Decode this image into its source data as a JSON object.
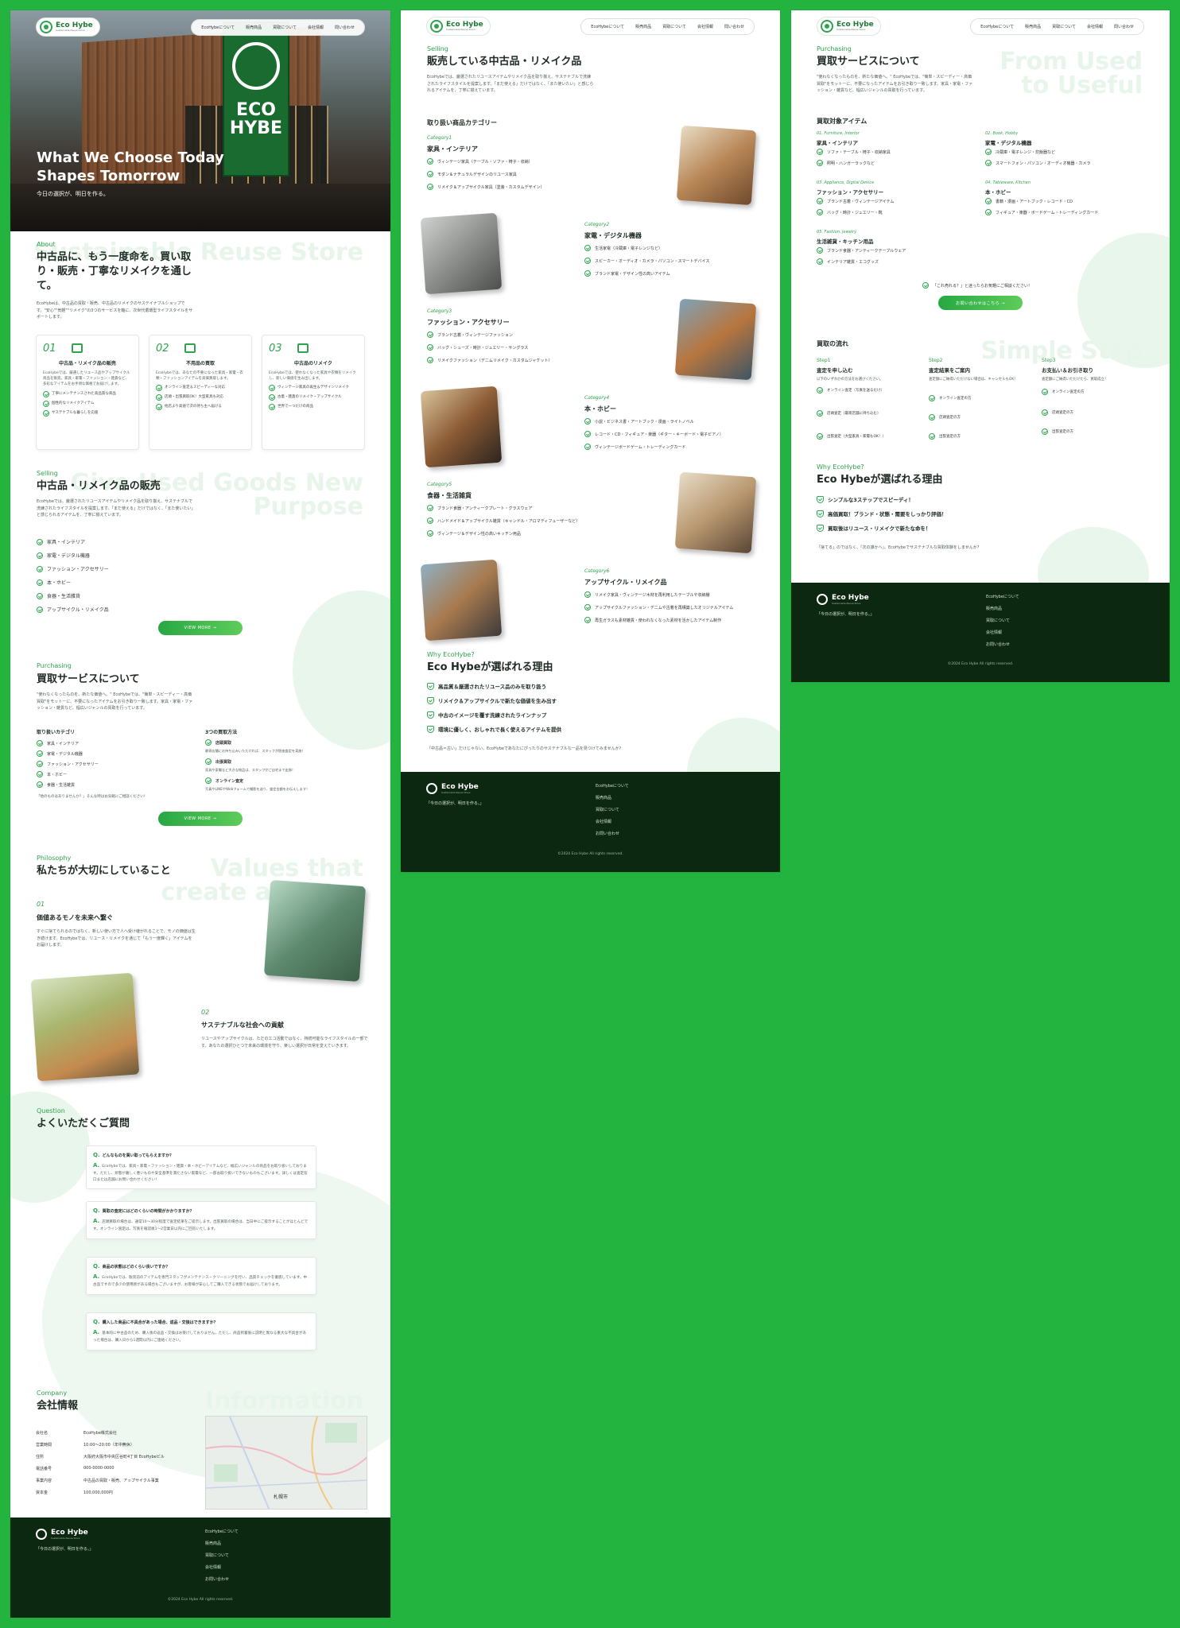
{
  "brand": {
    "name": "Eco Hybe",
    "tagline": "Sustainable Reuse Store"
  },
  "nav": [
    "EcoHybeについて",
    "販売商品",
    "買取について",
    "会社情報",
    "問い合わせ"
  ],
  "hero": {
    "title_line1": "What We Choose Today",
    "title_line2": "Shapes Tomorrow",
    "subtitle": "今日の選択が、明日を作る。",
    "sign_text": "ECO HYBE"
  },
  "about": {
    "eyebrow": "About",
    "heading": "中古品に、もう一度命を。買い取り・販売・丁寧なリメイクを通して。",
    "bgword": "Sustainable Reuse Store",
    "text": "EcoHybeは、中古品の買取・販売、中古品のリメイクのサステイナブルショップです。\"安心\"\"気軽\"\"リメイク\"の3つのサービスを軸に、次世代循環型ライフスタイルをサポートします。",
    "cards": [
      {
        "num": "01",
        "icon": "store-icon",
        "title": "中古品・リメイク品の販売",
        "text": "EcoHybeでは、厳選したリユース品やアップサイクル商品を販売。家具・家電・ファッション・雑貨など、多彩なアイテムをお手頃な価格でお届けします。",
        "items": [
          "丁寧にメンテナンスされた高品質な商品",
          "個性的なリメイクアイテム",
          "サステナブルな暮らしを応援"
        ]
      },
      {
        "num": "02",
        "icon": "scale-icon",
        "title": "不用品の買取",
        "text": "EcoHybeでは、あなたの不要になった家具・家電・衣類・ファッションアイテムを高価買取します。",
        "items": [
          "オンライン査定＆スピーディーな対応",
          "店頭・出張買取OK！大型家具も対応",
          "他店より高値で次の持ち主へ届ける"
        ]
      },
      {
        "num": "03",
        "icon": "tools-icon",
        "title": "中古品のリメイク",
        "text": "EcoHybeでは、使わなくなった家具や衣類をリメイクし、新しい価値を生み出します。",
        "items": [
          "ヴィンテージ家具の再生＆デザインリメイク",
          "古着・雑貨のリメイク・アップサイクル",
          "世界で一つだけの商品"
        ]
      }
    ]
  },
  "selling": {
    "eyebrow": "Selling",
    "heading": "中古品・リメイク品の販売",
    "bgword": "Give Used Goods New Purpose",
    "text": "EcoHybeでは、厳選されたリユースアイテムやリメイク品を取り揃え、サステナブルで洗練されたライフスタイルを提案します。「まだ使える」だけではなく、「また使いたい」と感じられるアイテムを、丁寧に揃えています。",
    "items": [
      "家具・インテリア",
      "家電・デジタル機器",
      "ファッション・アクセサリー",
      "本・ホビー",
      "食器・生活雑貨",
      "アップサイクル・リメイク品"
    ],
    "button": "VIEW MORE →"
  },
  "purchasing": {
    "eyebrow": "Purchasing",
    "heading": "買取サービスについて",
    "text": "\"使わなくなったものを、新たな価値へ。\" EcoHybeでは、\"簡単・スピーディー・高価買取\"をモットーに、不要になったアイテムをお引き取り一致します。家具・家電・ファッション・雑貨など、幅広いジャンルの買取を行っています。",
    "cat_heading": "取り扱いカテゴリ",
    "categories": [
      "家具・インテリア",
      "家電・デジタル機器",
      "ファッション・アクセサリー",
      "本・ホビー",
      "食器・生活雑貨"
    ],
    "cat_note": "「他のものはありませんか？」そんな時はお気軽にご相談ください！",
    "method_heading": "3つの買取方法",
    "methods": [
      {
        "title": "店頭買取",
        "text": "最寄店舗にお持ち込みいただければ、スタッフが即座査定を実施！"
      },
      {
        "title": "出張買取",
        "text": "家具や家電など大きな物品は、スタッフがご自宅まで出張！"
      },
      {
        "title": "オンライン査定",
        "text": "写真やLINEやWebフォームで撮影を送り、査定金額をお伝えします！"
      }
    ],
    "button": "VIEW MORE →"
  },
  "philosophy": {
    "eyebrow": "Philosophy",
    "heading": "私たちが大切にしていること",
    "bgword": "Values that create a better",
    "items": [
      {
        "num": "01",
        "title": "価値あるモノを未来へ繋ぐ",
        "text": "すぐに捨てられるのではなく、新しい使い方で人へ受け継がれることで、モノの価値は生き続けます。EcoHybeでは、リユース・リメイクを通じて「もう一度輝く」アイテムをお届けします。"
      },
      {
        "num": "02",
        "title": "サステナブルな社会への貢献",
        "text": "リユースやアップサイクルは、ただのエコ活動ではなく、持続可能なライフスタイルの一部です。あなたの選択ひとつで未来の環境を守り、楽しい選択が日常を変えていきます。"
      }
    ]
  },
  "faq": {
    "eyebrow": "Question",
    "heading": "よくいただくご質問",
    "items": [
      {
        "q": "どんなものを買い取ってもらえますか？",
        "a": "EcoHybeでは、家具・家電・ファッション・雑貨・本・ホビーアイテムなど、幅広いジャンルの商品をお取り扱いしております。ただし、状態が著しく悪いものや安全基準を満たさない家電など、一部お取り扱いできないものもございます。詳しくは査定窓口または店舗にお問い合わせください！"
      },
      {
        "q": "買取の査定にはどのくらいの時間がかかりますか？",
        "a": "店頭買取の場合は、通常10〜30分程度で査定結果をご提示します。出張買取の場合は、当日中にご提示することがほとんどです。オンライン査定は、写真を確認後1〜2営業日以内にご回答いたします。"
      },
      {
        "q": "商品の状態はどのくらい良いですか？",
        "a": "EcoHybeでは、販売前のアイテムを専門スタッフがメンテナンス・クリーニングを行い、品質チェックを徹底しています。中古品ですので多少の使用感がある場合もございますが、お客様が安心してご購入できる状態でお届けしております。"
      },
      {
        "q": "購入した商品に不具合があった場合、返品・交換はできますか？",
        "a": "基本的に中古品のため、購入後の返品・交換はお受けしておりません。ただし、商品到着後に説明と異なる重大な不具合があった場合は、購入日から1週間以内にご連絡ください。"
      }
    ]
  },
  "company": {
    "eyebrow": "Company",
    "heading": "会社情報",
    "bgword": "Information",
    "rows": [
      {
        "k": "会社名",
        "v": "EcoHybe株式会社"
      },
      {
        "k": "営業時間",
        "v": "10:00〜20:00（年中無休）"
      },
      {
        "k": "住所",
        "v": "大阪府大阪市中央区谷町4丁目 EcoHybeビル"
      },
      {
        "k": "電話番号",
        "v": "000-0000-0000"
      },
      {
        "k": "事業内容",
        "v": "中古品の買取・販売、アップサイクル事業"
      },
      {
        "k": "資本金",
        "v": "100,000,000円"
      }
    ],
    "map_label": "札幌市"
  },
  "footer": {
    "tag": "「今日の選択が、明日を作る。」",
    "links": [
      "EcoHybeについて",
      "販売商品",
      "買取について",
      "会社情報",
      "お問い合わせ"
    ],
    "copyright": "©2024 Eco Hybe All rights reserved."
  },
  "page2": {
    "eyebrow": "Selling",
    "heading": "販売している中古品・リメイク品",
    "text": "EcoHybeでは、厳選されたリユースアイテムやリメイク品を取り揃え、サステナブルで洗練されたライフスタイルを提案します。「まだ使える」だけではなく、「また使いたい」と感じられるアイテムを、丁寧に揃えています。",
    "cats_heading": "取り扱い商品カテゴリー",
    "categories": [
      {
        "label": "Category1",
        "title": "家具・インテリア",
        "items": [
          "ヴィンテージ家具（テーブル・ソファ・椅子・収納）",
          "モダン＆ナチュラルデザインのリユース家具",
          "リメイク＆アップサイクル家具（塗装・カスタムデザイン）"
        ]
      },
      {
        "label": "Category2",
        "title": "家電・デジタル機器",
        "items": [
          "生活家電（冷蔵庫・電子レンジなど）",
          "スピーカー・オーディオ・カメラ・パソコン・スマートデバイス",
          "ブランド家電・デザイン性の高いアイテム"
        ]
      },
      {
        "label": "Category3",
        "title": "ファッション・アクセサリー",
        "items": [
          "ブランド古着・ヴィンテージファッション",
          "バッグ・シューズ・時計・ジュエリー・サングラス",
          "リメイクファッション（デニムリメイク・カスタムジャケット）"
        ]
      },
      {
        "label": "Category4",
        "title": "本・ホビー",
        "items": [
          "小説・ビジネス書・アートブック・漫画・ライトノベル",
          "レコード・CD・フィギュア・楽器（ギター・キーボード・電子ピアノ）",
          "ヴィンテージボードゲーム・トレーディングカード"
        ]
      },
      {
        "label": "Category5",
        "title": "食器・生活雑貨",
        "items": [
          "ブランド食器・アンティークプレート・グラスウェア",
          "ハンドメイド＆アップサイクル雑貨（キャンドル・アロマディフューザーなど）",
          "ヴィンテージ＆デザイン性の高いキッチン用品"
        ]
      },
      {
        "label": "Category6",
        "title": "アップサイクル・リメイク品",
        "items": [
          "リメイク家具・ヴィンテージ木材を再利用したテーブルや収納棚",
          "アップサイクルファッション・デニムや古着を再構築したオリジナルアイテム",
          "再生ガラスも素材雑貨・使われなくなった素材を活かしたアイテム制作"
        ]
      }
    ],
    "why_eyebrow": "Why EcoHybe?",
    "why_heading": "Eco Hybeが選ばれる理由",
    "reasons": [
      "高品質＆厳選されたリユース品のみを取り扱う",
      "リメイク＆アップサイクルで新たな価値を生み出す",
      "中古のイメージを覆す洗練されたラインナップ",
      "環境に優しく、おしゃれで長く使えるアイテムを提供"
    ],
    "why_note": "「中古品＝古い」だけじゃない。EcoHybeであなたにぴったりのサステナブルな一品を見つけてみませんか？"
  },
  "page3": {
    "eyebrow": "Purchasing",
    "heading": "買取サービスについて",
    "bgword": "From Used to Useful",
    "text": "\"使わなくなったものを、新たな価値へ。\" EcoHybeでは、\"簡単・スピーディー・高価買取\"をモットーに、不要になったアイテムをお引き取り一致します。家具・家電・ファッション・雑貨など、幅広いジャンルの買取を行っています。",
    "items_heading": "買取対象アイテム",
    "groups": [
      {
        "label": "01. Furniture, Interior",
        "title": "家具・インテリア",
        "items": [
          "ソファ・テーブル・椅子・収納家具",
          "照明・ハンガーラックなど"
        ]
      },
      {
        "label": "02. Book, Hobby",
        "title": "家電・デジタル機器",
        "items": [
          "冷蔵庫・電子レンジ・炊飯器など",
          "スマートフォン・パソコン・オーディオ機器・カメラ"
        ]
      },
      {
        "label": "03. Appliance, Digital Device",
        "title": "ファッション・アクセサリー",
        "items": [
          "ブランド古着・ヴィンテージアイテム",
          "バッグ・時計・ジュエリー・靴"
        ]
      },
      {
        "label": "04. Tableware, Kitchen",
        "title": "本・ホビー",
        "items": [
          "書籍・漫画・アートブック・レコード・CD",
          "フィギュア・楽器・ボードゲーム・トレーディングカード"
        ]
      },
      {
        "label": "05. Fashion, Jewelry",
        "title": "生活雑貨・キッチン用品",
        "items": [
          "ブランド食器・アンティークテーブルウェア",
          "インテリア雑貨・エコグッズ"
        ]
      }
    ],
    "question": "「これ売れる？」と迷ったらお気軽にご相談ください！",
    "cta": "お問い合わせはこちら →",
    "flow_heading": "買取の流れ",
    "flow_bgword": "Simple Step",
    "steps": [
      {
        "label": "Step1",
        "title": "査定を申し込む",
        "text": "以下のいずれかの方法をお選びください。",
        "items": [
          "オンライン査定（写真を送るだけ）",
          "店頭査定（最寄店舗に持ち込む）",
          "出張査定（大型家具・家電もOK！）"
        ]
      },
      {
        "label": "Step2",
        "title": "査定結果をご案内",
        "text": "査定額にご納得いただけない場合は、キャンセルもOK！",
        "items": [
          "オンライン査定の方",
          "店頭査定の方",
          "出張査定の方"
        ]
      },
      {
        "label": "Step3",
        "title": "お支払い＆お引き取り",
        "text": "査定額にご納得いただけたら、買取成立！",
        "items": [
          "オンライン査定の方",
          "店頭査定の方",
          "出張査定の方"
        ]
      }
    ],
    "why_eyebrow": "Why EcoHybe?",
    "why_heading": "Eco Hybeが選ばれる理由",
    "reasons": [
      "シンプルな3ステップでスピーディ！",
      "高価買取！ブランド・状態・需要をしっかり評価！",
      "買取後はリユース・リメイクで新たな命を！"
    ],
    "why_note": "「捨てる」のではなく、「次の誰かへ」。EcoHybeでサステナブルな買取体験をしませんか？"
  }
}
